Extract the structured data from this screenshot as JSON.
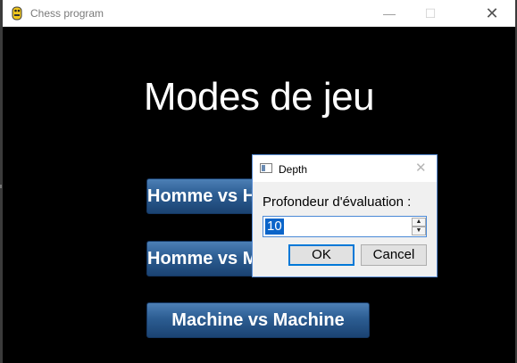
{
  "window": {
    "title": "Chess program",
    "minimize": "—",
    "maximize": "☐",
    "close": "✕"
  },
  "main": {
    "heading": "Modes de jeu",
    "buttons": [
      {
        "label": "Homme vs Homme"
      },
      {
        "label": "Homme vs Machine"
      },
      {
        "label": "Machine vs Machine"
      }
    ]
  },
  "dialog": {
    "title": "Depth",
    "close": "✕",
    "label": "Profondeur d'évaluation :",
    "value": "10",
    "up": "▲",
    "down": "▼",
    "ok": "OK",
    "cancel": "Cancel"
  }
}
